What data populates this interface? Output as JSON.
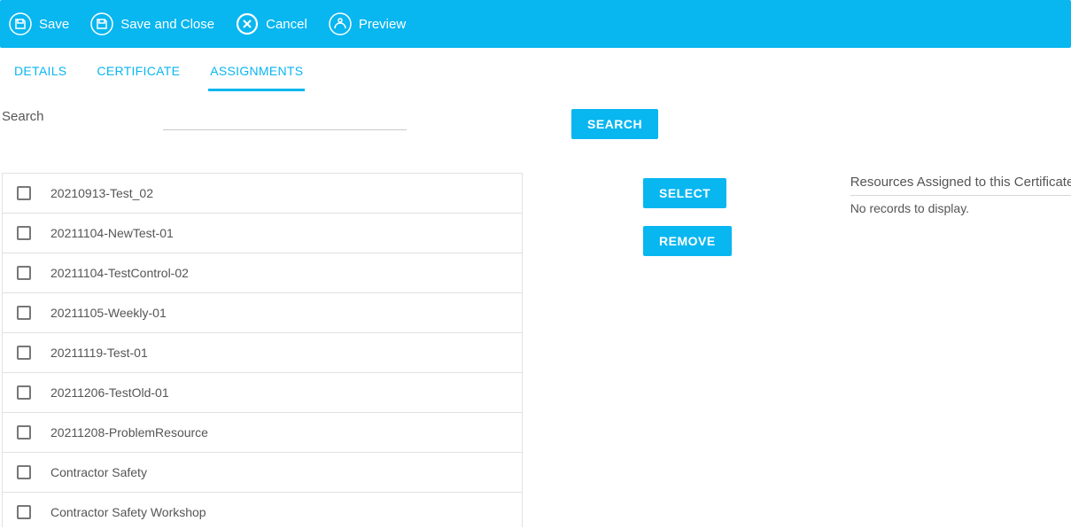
{
  "toolbar": {
    "save": "Save",
    "save_close": "Save and Close",
    "cancel": "Cancel",
    "preview": "Preview"
  },
  "tabs": {
    "details": "DETAILS",
    "certificate": "CERTIFICATE",
    "assignments": "ASSIGNMENTS"
  },
  "search": {
    "label": "Search",
    "value": "",
    "button": "SEARCH"
  },
  "actions": {
    "select": "SELECT",
    "remove": "REMOVE"
  },
  "resources": [
    "20210913-Test_02",
    "20211104-NewTest-01",
    "20211104-TestControl-02",
    "20211105-Weekly-01",
    "20211119-Test-01",
    "20211206-TestOld-01",
    "20211208-ProblemResource",
    "Contractor Safety",
    "Contractor Safety Workshop"
  ],
  "assigned": {
    "title": "Resources Assigned to this Certificate",
    "empty": "No records to display."
  }
}
